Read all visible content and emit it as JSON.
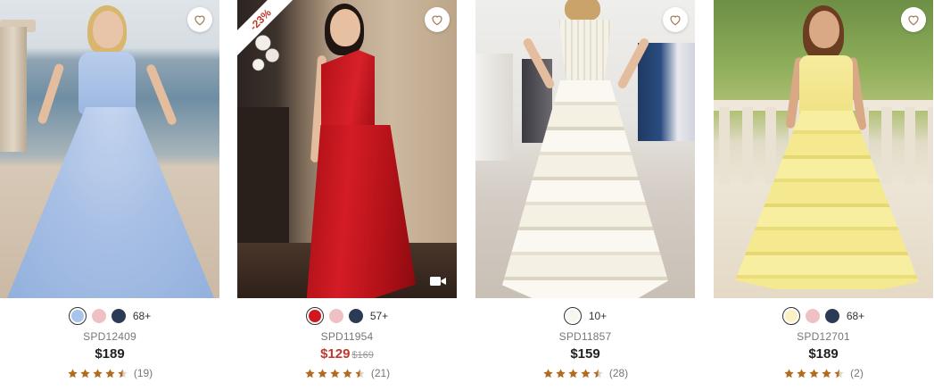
{
  "products": [
    {
      "sku": "SPD12409",
      "price": "$189",
      "original_price": "",
      "discount": "",
      "rating_count": "(19)",
      "more_colors": "68+",
      "swatches": [
        "#a9c4ea",
        "#efc1c4",
        "#2c3b55"
      ],
      "selected_swatch": 0,
      "has_video": false
    },
    {
      "sku": "SPD11954",
      "price": "$129",
      "original_price": "$169",
      "discount": "-23%",
      "rating_count": "(21)",
      "more_colors": "57+",
      "swatches": [
        "#d0171f",
        "#efc1c4",
        "#2c3b55"
      ],
      "selected_swatch": 0,
      "has_video": true
    },
    {
      "sku": "SPD11857",
      "price": "$159",
      "original_price": "",
      "discount": "",
      "rating_count": "(28)",
      "more_colors": "10+",
      "swatches": [
        "#f8f6ef"
      ],
      "selected_swatch": 0,
      "has_video": false
    },
    {
      "sku": "SPD12701",
      "price": "$189",
      "original_price": "",
      "discount": "",
      "rating_count": "(2)",
      "more_colors": "68+",
      "swatches": [
        "#fbf2c4",
        "#efc1c4",
        "#2c3b55"
      ],
      "selected_swatch": 0,
      "has_video": false
    }
  ],
  "rating_stars": 4.5,
  "colors": {
    "star": "#b36b1f",
    "sale_price": "#c0392b",
    "heart": "#a07a52"
  },
  "icons": {
    "wishlist": "heart-outline-icon",
    "video": "video-camera-icon",
    "rating": "star-icon"
  }
}
